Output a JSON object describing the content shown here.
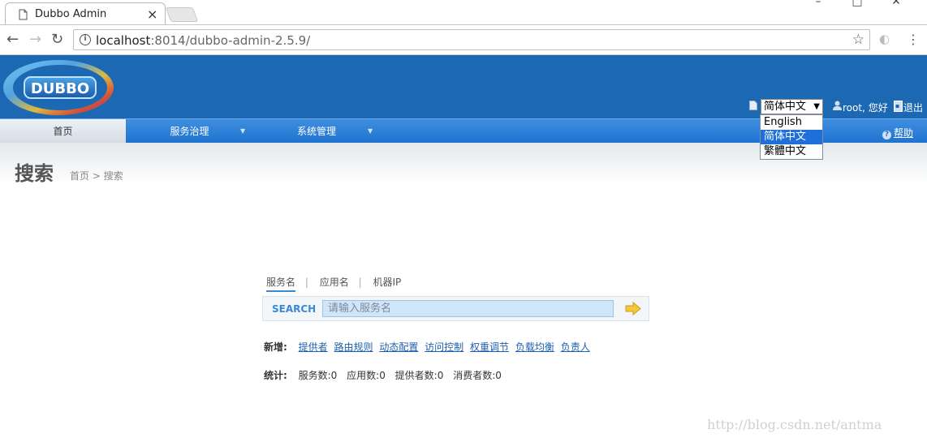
{
  "browser": {
    "tab_title": "Dubbo Admin",
    "tab_close": "×",
    "url_host": "localhost",
    "url_rest": ":8014/dubbo-admin-2.5.9/"
  },
  "header": {
    "logo_text": "DUBBO",
    "language": {
      "selected": "简体中文",
      "options": [
        "English",
        "简体中文",
        "繁體中文"
      ]
    },
    "user_greeting": "root, 您好",
    "logout": "退出"
  },
  "nav": {
    "items": [
      {
        "label": "首页"
      },
      {
        "label": "服务治理"
      },
      {
        "label": "系统管理"
      }
    ],
    "help": "帮助"
  },
  "title": {
    "heading": "搜索",
    "breadcrumb": "首页 > 搜索"
  },
  "search": {
    "tabs": [
      "服务名",
      "应用名",
      "机器IP"
    ],
    "label": "SEARCH",
    "placeholder": "请输入服务名"
  },
  "add_row": {
    "label": "新增:",
    "links": [
      "提供者",
      "路由规则",
      "动态配置",
      "访问控制",
      "权重调节",
      "负载均衡",
      "负责人"
    ]
  },
  "stats_row": {
    "label": "统计:",
    "items": [
      "服务数:0",
      "应用数:0",
      "提供者数:0",
      "消费者数:0"
    ]
  },
  "watermark": "http://blog.csdn.net/antma",
  "colors": {
    "header_blue": "#1d68b3",
    "nav_blue": "#2a7ad4",
    "link_blue": "#1d5fae",
    "dropdown_selected": "#1e6fd9"
  }
}
